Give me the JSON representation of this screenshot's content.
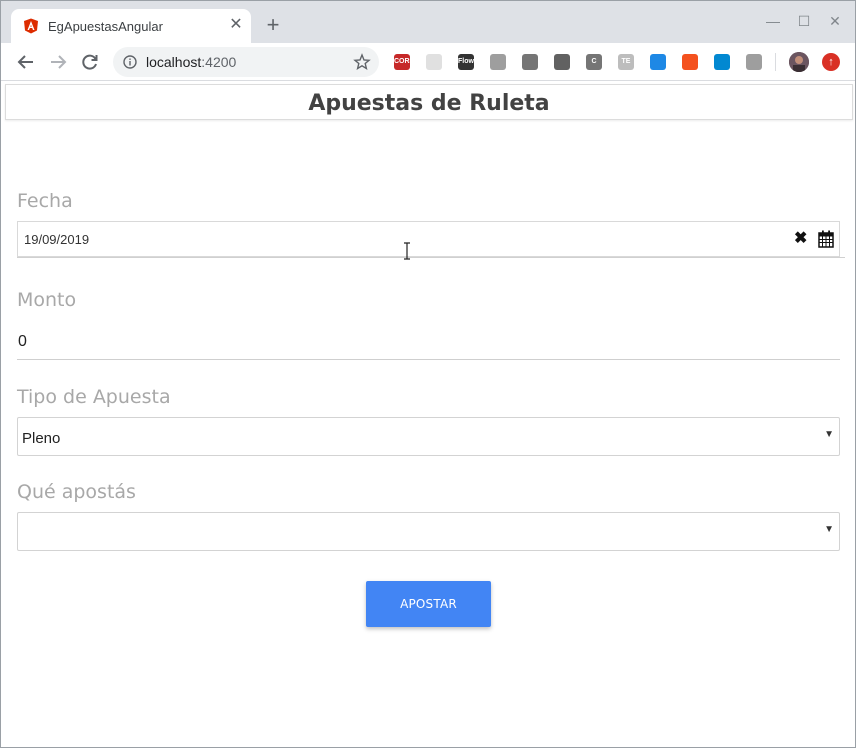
{
  "browser": {
    "tab_title": "EgApuestasAngular",
    "tab_close": "✕",
    "new_tab": "+",
    "url_host": "localhost",
    "url_port": ":4200",
    "window_controls": [
      "—",
      "☐",
      "✕"
    ],
    "extensions": [
      {
        "name": "cors-extension-icon",
        "label": "CORS",
        "color": "#c62828"
      },
      {
        "name": "grid-extension-icon",
        "label": "",
        "color": "#e0e0e0"
      },
      {
        "name": "flow-extension-icon",
        "label": "Flow",
        "color": "#333333"
      },
      {
        "name": "vue-extension-icon",
        "label": "",
        "color": "#9e9e9e"
      },
      {
        "name": "cube-extension-icon",
        "label": "",
        "color": "#757575"
      },
      {
        "name": "apps-extension-icon",
        "label": "",
        "color": "#616161"
      },
      {
        "name": "c-extension-icon",
        "label": "C",
        "color": "#757575"
      },
      {
        "name": "te-extension-icon",
        "label": "TE",
        "color": "#bdbdbd"
      },
      {
        "name": "trello-extension-icon",
        "label": "",
        "color": "#1e88e5"
      },
      {
        "name": "orange-extension-icon",
        "label": "",
        "color": "#f4511e"
      },
      {
        "name": "wave-extension-icon",
        "label": "",
        "color": "#0288d1"
      },
      {
        "name": "triangle-extension-icon",
        "label": "",
        "color": "#9e9e9e"
      }
    ],
    "update_badge": "↑"
  },
  "page": {
    "title": "Apuestas de Ruleta",
    "fecha": {
      "label": "Fecha",
      "value": "19/09/2019",
      "clear": "✖"
    },
    "monto": {
      "label": "Monto",
      "value": "0"
    },
    "tipo": {
      "label": "Tipo de Apuesta",
      "value": "Pleno"
    },
    "que": {
      "label": "Qué apostás",
      "value": ""
    },
    "submit_label": "APOSTAR"
  },
  "colors": {
    "accent": "#4285f4",
    "label": "#a8a8a8"
  }
}
